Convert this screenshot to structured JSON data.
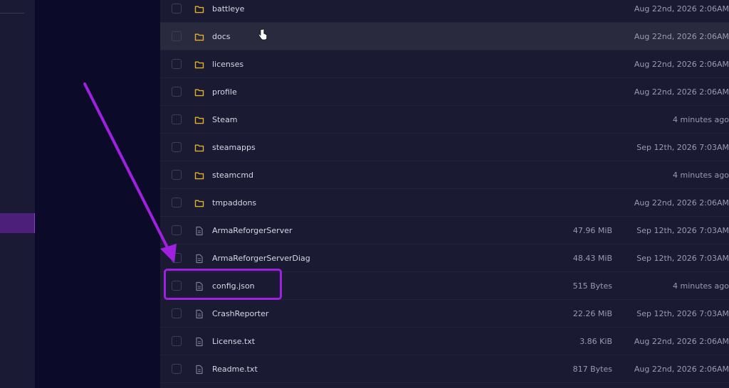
{
  "colors": {
    "folder": "#e0b12a",
    "file": "#7d7c92",
    "annotation": "#a020e0",
    "active_nav": "#4c1f7a"
  },
  "files": [
    {
      "type": "folder",
      "icon": "folder-icon",
      "name": "battleye",
      "size": "",
      "modified": "Aug 22nd, 2026 2:06AM"
    },
    {
      "type": "folder",
      "icon": "folder-icon",
      "name": "docs",
      "size": "",
      "modified": "Aug 22nd, 2026 2:06AM"
    },
    {
      "type": "folder",
      "icon": "folder-icon",
      "name": "licenses",
      "size": "",
      "modified": "Aug 22nd, 2026 2:06AM"
    },
    {
      "type": "folder",
      "icon": "folder-icon",
      "name": "profile",
      "size": "",
      "modified": "Aug 22nd, 2026 2:06AM"
    },
    {
      "type": "folder",
      "icon": "folder-icon",
      "name": "Steam",
      "size": "",
      "modified": "4 minutes ago"
    },
    {
      "type": "folder",
      "icon": "folder-icon",
      "name": "steamapps",
      "size": "",
      "modified": "Sep 12th, 2026 7:03AM"
    },
    {
      "type": "folder",
      "icon": "folder-icon",
      "name": "steamcmd",
      "size": "",
      "modified": "4 minutes ago"
    },
    {
      "type": "folder",
      "icon": "folder-icon",
      "name": "tmpaddons",
      "size": "",
      "modified": "Aug 22nd, 2026 2:06AM"
    },
    {
      "type": "file",
      "icon": "file-icon",
      "name": "ArmaReforgerServer",
      "size": "47.96 MiB",
      "modified": "Sep 12th, 2026 7:03AM"
    },
    {
      "type": "file",
      "icon": "file-icon",
      "name": "ArmaReforgerServerDiag",
      "size": "48.43 MiB",
      "modified": "Sep 12th, 2026 7:03AM"
    },
    {
      "type": "file",
      "icon": "file-icon",
      "name": "config.json",
      "size": "515 Bytes",
      "modified": "4 minutes ago"
    },
    {
      "type": "file",
      "icon": "file-icon",
      "name": "CrashReporter",
      "size": "22.26 MiB",
      "modified": "Sep 12th, 2026 7:03AM"
    },
    {
      "type": "file",
      "icon": "file-icon",
      "name": "License.txt",
      "size": "3.86 KiB",
      "modified": "Aug 22nd, 2026 2:06AM"
    },
    {
      "type": "file",
      "icon": "file-icon",
      "name": "Readme.txt",
      "size": "817 Bytes",
      "modified": "Aug 22nd, 2026 2:06AM"
    }
  ]
}
